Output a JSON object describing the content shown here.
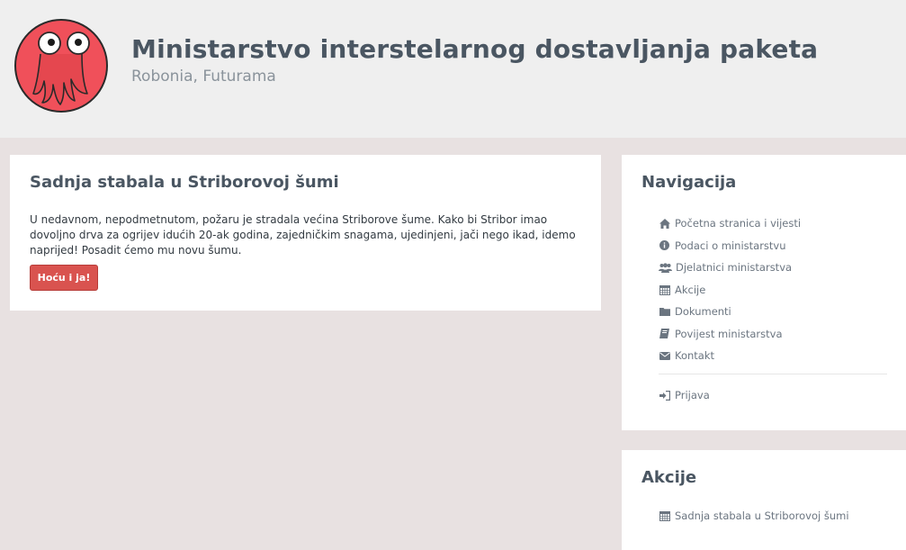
{
  "header": {
    "title": "Ministarstvo interstelarnog dostavljanja paketa",
    "subtitle": "Robonia, Futurama",
    "logo_icon": "octopus-mascot-icon"
  },
  "main": {
    "title": "Sadnja stabala u Striborovoj šumi",
    "text": "U nedavnom, nepodmetnutom, požaru je stradala većina Striborove šume. Kako bi Stribor imao dovoljno drva za ogrijev idućih 20-ak godina, zajedničkim snagama, ujedinjeni, jači nego ikad, idemo naprijed! Posadit ćemo mu novu šumu.",
    "button_label": "Hoću i ja!"
  },
  "navigation": {
    "title": "Navigacija",
    "items": [
      {
        "label": "Početna stranica i vijesti",
        "icon": "home-icon"
      },
      {
        "label": "Podaci o ministarstvu",
        "icon": "info-icon"
      },
      {
        "label": "Djelatnici ministarstva",
        "icon": "users-icon"
      },
      {
        "label": "Akcije",
        "icon": "calendar-icon"
      },
      {
        "label": "Dokumenti",
        "icon": "folder-icon"
      },
      {
        "label": "Povijest ministarstva",
        "icon": "book-icon"
      },
      {
        "label": "Kontakt",
        "icon": "envelope-icon"
      }
    ],
    "login_label": "Prijava",
    "login_icon": "sign-in-icon"
  },
  "actions": {
    "title": "Akcije",
    "items": [
      {
        "label": "Sadnja stabala u Striborovoj šumi",
        "icon": "calendar-icon"
      }
    ]
  },
  "colors": {
    "background": "#e8e1e1",
    "header": "#efefef",
    "accent_button": "#d9534f",
    "logo": "#f0505a"
  }
}
